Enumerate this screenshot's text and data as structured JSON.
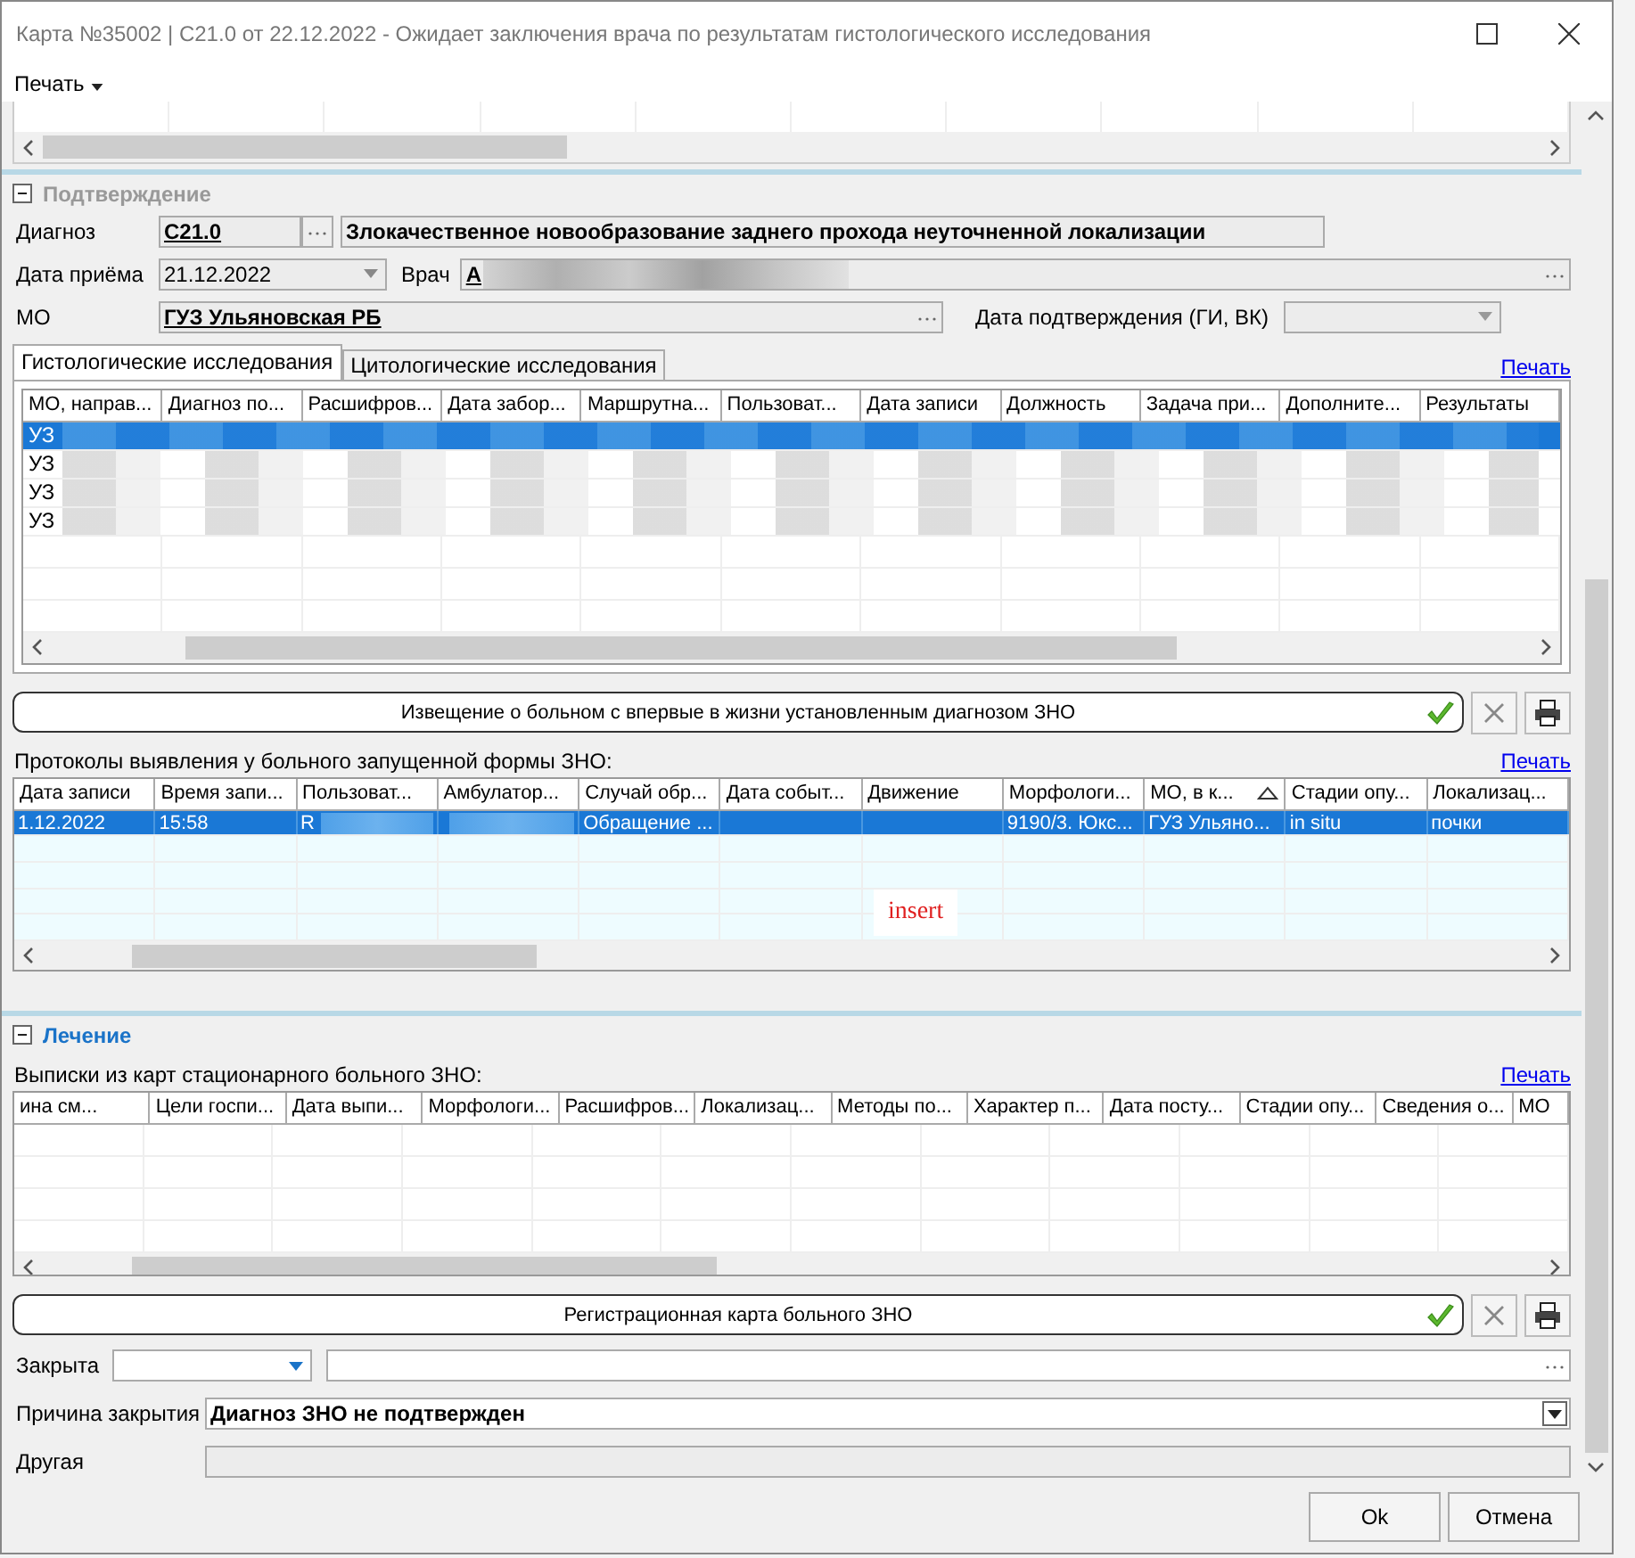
{
  "window": {
    "title": "Карта №35002 | С21.0 от 22.12.2022 - Ожидает заключения врача по результатам гистологического исследования"
  },
  "menu": [
    {
      "label": "Печать"
    }
  ],
  "confirmation": {
    "header": "Подтверждение",
    "expanded": true,
    "diagnosis_label": "Диагноз",
    "diagnosis_code": "С21.0",
    "diagnosis_text": "Злокачественное новообразование заднего прохода неуточненной локализации",
    "date_label": "Дата приёма",
    "date": "21.12.2022",
    "doctor_label": "Врач",
    "doctor": "А",
    "mo_label": "МО",
    "mo": "ГУЗ Ульяновская РБ",
    "confirm_date_label": "Дата подтверждения (ГИ, ВК)"
  },
  "tabs": [
    {
      "label": "Гистологические исследования",
      "selected": true
    },
    {
      "label": "Цитологические исследования",
      "selected": false
    }
  ],
  "tabs_print": "Печать",
  "histology_table": {
    "columns": [
      "МО, направ...",
      "Диагноз по...",
      "Расшифров...",
      "Дата забор...",
      "Маршрутна...",
      "Пользоват...",
      "Дата записи",
      "Должность",
      "Задача при...",
      "Дополните...",
      "Результаты"
    ],
    "rows": [
      {
        "text": "УЗ",
        "selected": true
      },
      {
        "text": "УЗ",
        "selected": false
      },
      {
        "text": "УЗ",
        "selected": false
      },
      {
        "text": "УЗ",
        "selected": false
      }
    ]
  },
  "notice_button": "Извещение о больном с впервые в жизни установленным диагнозом ЗНО",
  "protocols": {
    "label": "Протоколы выявления у больного запущенной формы ЗНО:",
    "print": "Печать",
    "columns": [
      {
        "label": "Дата записи",
        "sorted": false
      },
      {
        "label": "Время запи...",
        "sorted": false
      },
      {
        "label": "Пользоват...",
        "sorted": false
      },
      {
        "label": "Амбулатор...",
        "sorted": false
      },
      {
        "label": "Случай обр...",
        "sorted": false
      },
      {
        "label": "Дата событ...",
        "sorted": false
      },
      {
        "label": "Движение",
        "sorted": false
      },
      {
        "label": "Морфологи...",
        "sorted": false
      },
      {
        "label": "МО, в к...",
        "sorted": true
      },
      {
        "label": "Стадии опу...",
        "sorted": false
      },
      {
        "label": "Локализац...",
        "sorted": false
      }
    ],
    "rows": [
      {
        "selected": true,
        "cells": [
          {
            "text": "1.12.2022"
          },
          {
            "text": "15:58"
          },
          {
            "text": "R",
            "blurred": true
          },
          {
            "blurred": true
          },
          {
            "text": "Обращение ..."
          },
          {},
          {},
          {
            "text": "9190/3. Юкс..."
          },
          {
            "text": "ГУЗ Ульяно..."
          },
          {
            "text": "in situ"
          },
          {
            "text": "почки"
          }
        ]
      }
    ]
  },
  "overlay_label": "insert",
  "treatment": {
    "header": "Лечение",
    "expanded": true,
    "label": "Выписки из карт стационарного больного ЗНО:",
    "print": "Печать",
    "columns": [
      "ина см...",
      "Цели госпи...",
      "Дата выпи...",
      "Морфологи...",
      "Расшифров...",
      "Локализац...",
      "Методы по...",
      "Характер п...",
      "Дата посту...",
      "Стадии опу...",
      "Сведения о...",
      "МО"
    ]
  },
  "registration_button": "Регистрационная карта больного ЗНО",
  "closed": {
    "label": "Закрыта"
  },
  "reason": {
    "label": "Причина закрытия",
    "value": "Диагноз ЗНО не подтвержден"
  },
  "other": {
    "label": "Другая"
  },
  "buttons": [
    "Ok",
    "Отмена"
  ]
}
